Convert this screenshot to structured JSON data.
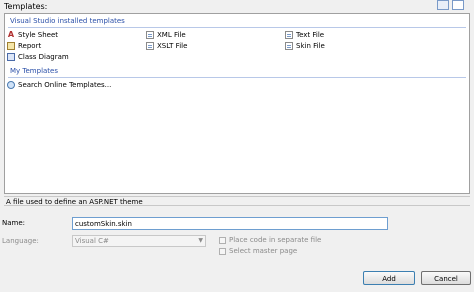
{
  "header": {
    "templates_label": "Templates:"
  },
  "groups": {
    "installed_header": "Visual Studio installed templates",
    "my_header": "My Templates"
  },
  "installed_items": [
    {
      "label": "Style Sheet",
      "icon": "css-icon"
    },
    {
      "label": "XML File",
      "icon": "xml-file-icon"
    },
    {
      "label": "Text File",
      "icon": "text-file-icon"
    },
    {
      "label": "Report",
      "icon": "report-icon"
    },
    {
      "label": "XSLT File",
      "icon": "xslt-file-icon"
    },
    {
      "label": "Skin File",
      "icon": "skin-file-icon",
      "selected": true
    },
    {
      "label": "Class Diagram",
      "icon": "class-diagram-icon"
    }
  ],
  "my_items": [
    {
      "label": "Search Online Templates...",
      "icon": "globe-icon"
    }
  ],
  "description": "A file used to define an ASP.NET theme",
  "form": {
    "name_label": "Name:",
    "name_value": "customSkin.skin",
    "language_label": "Language:",
    "language_value": "Visual C#",
    "separate_file_label": "Place code in separate file",
    "master_page_label": "Select master page"
  },
  "buttons": {
    "add": "Add",
    "cancel": "Cancel"
  },
  "colors": {
    "group_header": "#2a4fa8",
    "focus_border": "#6e9ed0"
  }
}
